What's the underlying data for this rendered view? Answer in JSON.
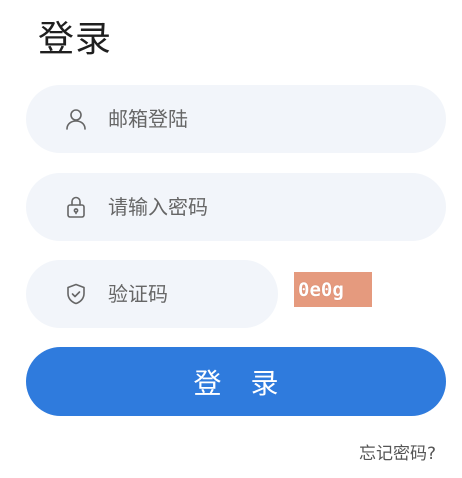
{
  "title": "登录",
  "email_field": {
    "placeholder": "邮箱登陆",
    "icon": "user-icon",
    "value": ""
  },
  "password_field": {
    "placeholder": "请输入密码",
    "icon": "lock-icon",
    "value": ""
  },
  "captcha_field": {
    "placeholder": "验证码",
    "icon": "shield-icon",
    "value": ""
  },
  "captcha_image": {
    "text": "0e0g",
    "background_color": "#e59a7e"
  },
  "login_button": {
    "label": "登 录",
    "color": "#2f7bdd"
  },
  "forgot_password": {
    "label": "忘记密码?"
  }
}
